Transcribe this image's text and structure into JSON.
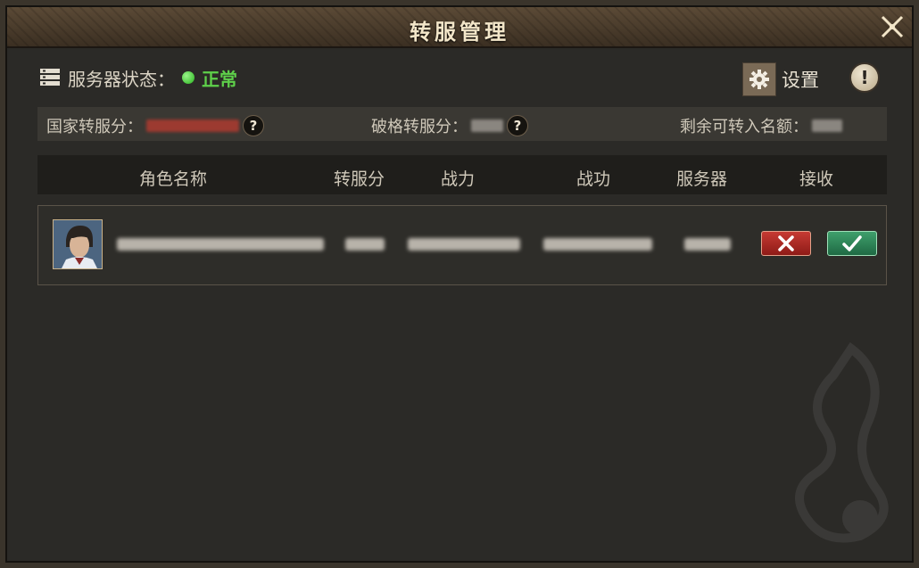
{
  "window": {
    "title": "转服管理"
  },
  "status": {
    "label": "服务器状态：",
    "value": "正常",
    "value_color": "#5ed04a"
  },
  "settings": {
    "label": "设置"
  },
  "info": {
    "symbol": "!"
  },
  "quota": {
    "national_label": "国家转服分：",
    "special_label": "破格转服分：",
    "remaining_label": "剩余可转入名额：",
    "help_symbol": "?"
  },
  "table": {
    "headers": [
      "角色名称",
      "转服分",
      "战力",
      "战功",
      "服务器",
      "接收"
    ]
  },
  "icons": {
    "close": "close-icon",
    "server": "server-icon",
    "gear": "gear-icon",
    "reject": "reject-icon",
    "accept": "accept-icon"
  }
}
